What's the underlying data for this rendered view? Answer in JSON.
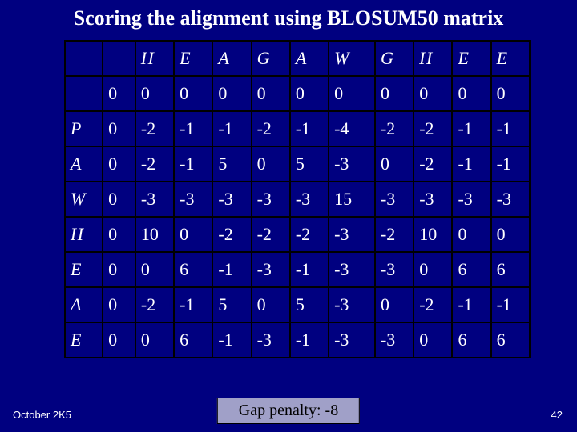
{
  "title": "Scoring the alignment using BLOSUM50 matrix",
  "col_headers": [
    "H",
    "E",
    "A",
    "G",
    "A",
    "W",
    "G",
    "H",
    "E",
    "E"
  ],
  "row_headers": [
    "P",
    "A",
    "W",
    "H",
    "E",
    "A",
    "E"
  ],
  "rows": [
    [
      "",
      "0",
      "0",
      "0",
      "0",
      "0",
      "0",
      "0",
      "0",
      "0",
      "0",
      "0"
    ],
    [
      "P",
      "0",
      "-2",
      "-1",
      "-1",
      "-2",
      "-1",
      "-4",
      "-2",
      "-2",
      "-1",
      "-1"
    ],
    [
      "A",
      "0",
      "-2",
      "-1",
      "5",
      "0",
      "5",
      "-3",
      "0",
      "-2",
      "-1",
      "-1"
    ],
    [
      "W",
      "0",
      "-3",
      "-3",
      "-3",
      "-3",
      "-3",
      "15",
      "-3",
      "-3",
      "-3",
      "-3"
    ],
    [
      "H",
      "0",
      "10",
      "0",
      "-2",
      "-2",
      "-2",
      "-3",
      "-2",
      "10",
      "0",
      "0"
    ],
    [
      "E",
      "0",
      "0",
      "6",
      "-1",
      "-3",
      "-1",
      "-3",
      "-3",
      "0",
      "6",
      "6"
    ],
    [
      "A",
      "0",
      "-2",
      "-1",
      "5",
      "0",
      "5",
      "-3",
      "0",
      "-2",
      "-1",
      "-1"
    ],
    [
      "E",
      "0",
      "0",
      "6",
      "-1",
      "-3",
      "-1",
      "-3",
      "-3",
      "0",
      "6",
      "6"
    ]
  ],
  "footer": {
    "date": "October 2K5",
    "badge": "Gap penalty: -8",
    "page_number": "42"
  }
}
